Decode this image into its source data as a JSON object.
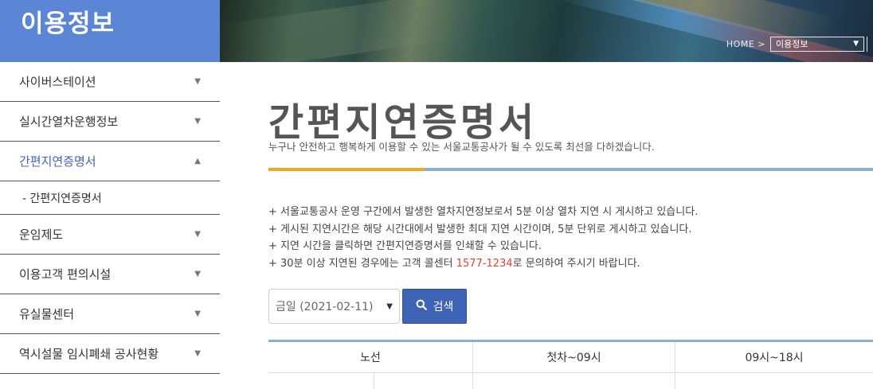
{
  "header": {
    "section_title": "이용정보",
    "breadcrumb_home": "HOME >",
    "breadcrumb_select": "이용정보"
  },
  "sidebar": {
    "items": [
      {
        "label": "사이버스테이션",
        "state": "collapsed"
      },
      {
        "label": "실시간열차운행정보",
        "state": "collapsed"
      },
      {
        "label": "간편지연증명서",
        "state": "expanded"
      },
      {
        "label": "운임제도",
        "state": "collapsed"
      },
      {
        "label": "이용고객 편의시설",
        "state": "collapsed"
      },
      {
        "label": "유실물센터",
        "state": "collapsed"
      },
      {
        "label": "역시설물 임시폐쇄 공사현황",
        "state": "collapsed"
      }
    ],
    "sub_item": "- 간편지연증명서"
  },
  "main": {
    "title": "간편지연증명서",
    "subtitle": "누구나 안전하고 행복하게 이용할 수 있는 서울교통공사가 될 수 있도록 최선을 다하겠습니다.",
    "notes": [
      "+ 서울교통공사 운영 구간에서 발생한 열차지연정보로서 5분 이상 열차 지연 시 게시하고 있습니다.",
      "+ 게시된 지연시간은 해당 시간대에서 발생한 최대 지연 시간이며, 5분 단위로 게시하고 있습니다.",
      "+ 지연 시간을 클릭하면 간편지연증명서를 인쇄할 수 있습니다."
    ],
    "note4_prefix": "+ 30분 이상 지연된 경우에는 고객 콜센터 ",
    "note4_phone": "1577-1234",
    "note4_suffix": "로 문의하여 주시기 바랍니다.",
    "date_select_value": "금일 (2021-02-11)",
    "search_label": "검색",
    "table_headers": [
      "노선",
      "첫차~09시",
      "09시~18시"
    ]
  },
  "colors": {
    "brand_blue": "#5b86d6",
    "active_text": "#3f63b5",
    "accent_orange": "#f0a81c",
    "rule_blue": "#8fb0cc",
    "phone_red": "#e0432e"
  },
  "icons": {
    "sidebar_collapsed": "triangle-down-icon",
    "sidebar_expanded": "triangle-up-icon",
    "search": "search-icon",
    "select": "chevron-down-icon"
  }
}
